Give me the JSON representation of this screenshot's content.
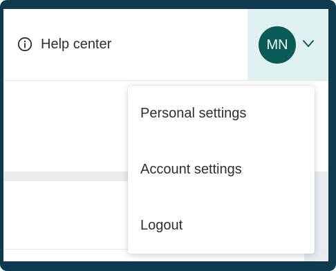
{
  "header": {
    "help_label": "Help center",
    "avatar_initials": "MN"
  },
  "menu": {
    "items": [
      {
        "label": "Personal settings"
      },
      {
        "label": "Account settings"
      },
      {
        "label": "Logout"
      }
    ]
  },
  "colors": {
    "frame": "#0d3a4f",
    "avatar_bg": "#0a5b57",
    "avatar_area_bg": "#e0f1f1",
    "chevron": "#0a5b57"
  }
}
